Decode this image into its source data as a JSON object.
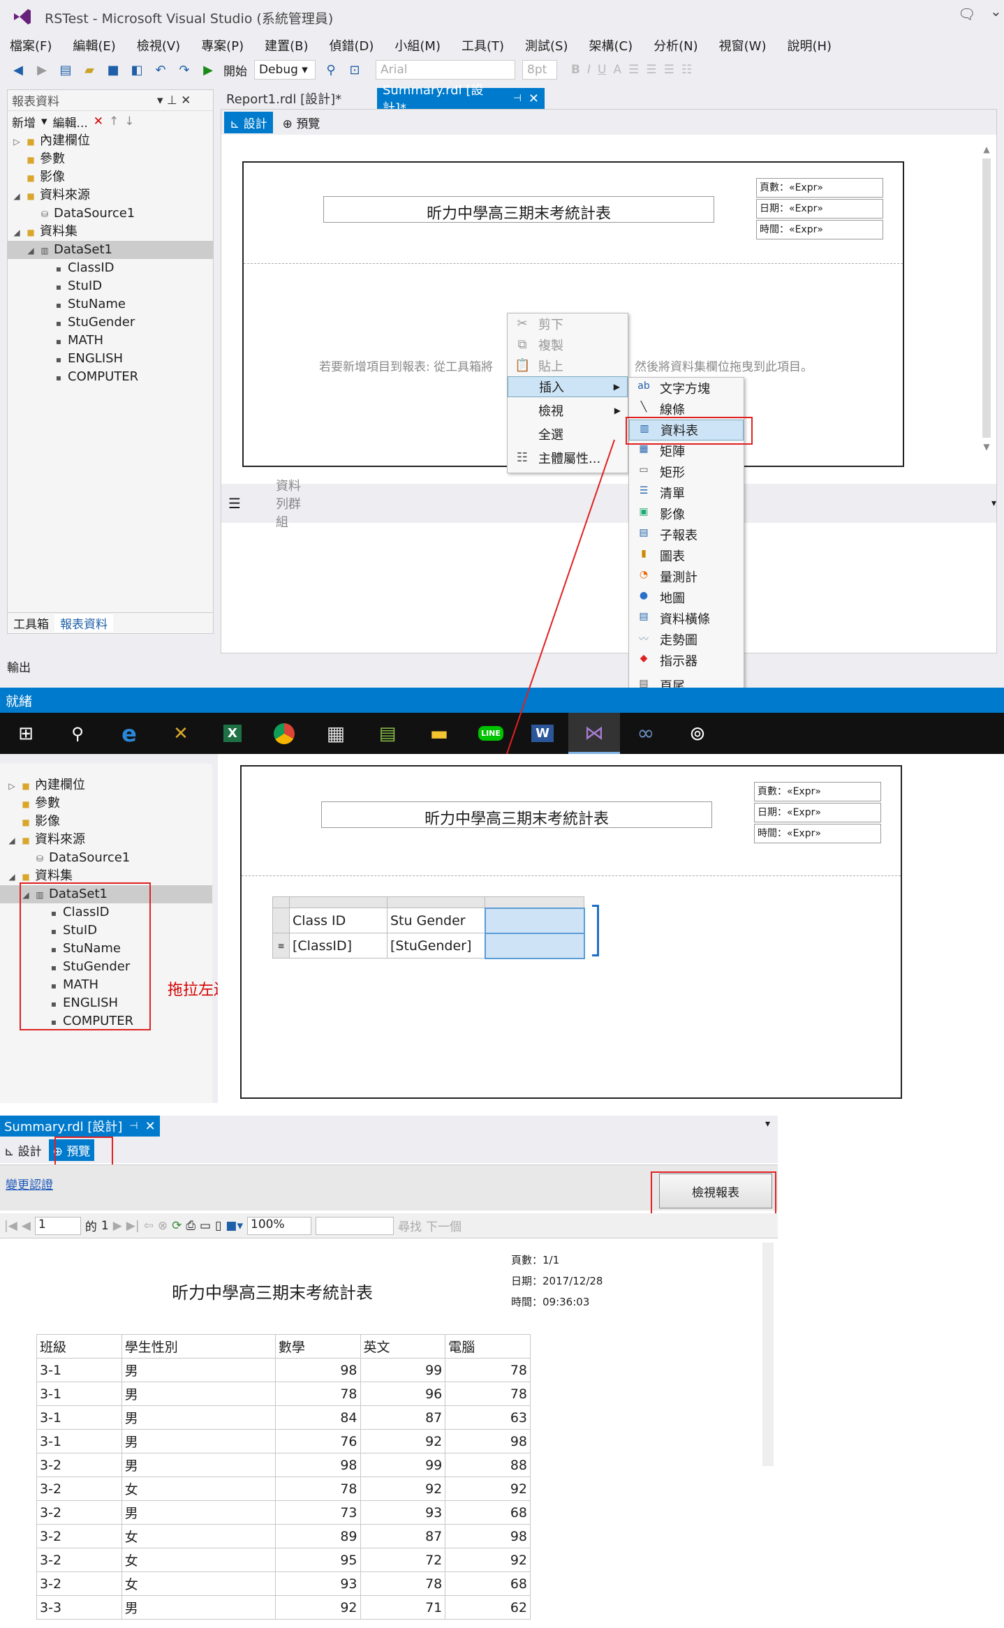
{
  "window": {
    "title": "RSTest - Microsoft Visual Studio (系統管理員)"
  },
  "menu": [
    "檔案(F)",
    "編輯(E)",
    "檢視(V)",
    "專案(P)",
    "建置(B)",
    "偵錯(D)",
    "小組(M)",
    "工具(T)",
    "測試(S)",
    "架構(C)",
    "分析(N)",
    "視窗(W)",
    "說明(H)"
  ],
  "toolbar": {
    "start": "開始",
    "config": "Debug",
    "font": "Arial",
    "size": "8pt"
  },
  "report_data_panel": {
    "title": "報表資料",
    "new": "新增",
    "edit": "編輯..."
  },
  "tree": {
    "builtin": "內建欄位",
    "params": "參數",
    "images": "影像",
    "datasources": "資料來源",
    "datasource1": "DataSource1",
    "datasets": "資料集",
    "dataset1": "DataSet1",
    "fields": [
      "ClassID",
      "StuID",
      "StuName",
      "StuGender",
      "MATH",
      "ENGLISH",
      "COMPUTER"
    ]
  },
  "bottom_tabs": {
    "toolbox": "工具箱",
    "report_data": "報表資料"
  },
  "output": "輸出",
  "doc_tabs": {
    "report1": "Report1.rdl [設計]*",
    "summary": "Summary.rdl [設計]*",
    "summary_clean": "Summary.rdl [設計]"
  },
  "view_tabs": {
    "design": "設計",
    "preview": "預覽"
  },
  "report": {
    "title": "昕力中學高三期末考統計表",
    "page_expr": "頁數：«Expr»",
    "date_expr": "日期：«Expr»",
    "time_expr": "時間：«Expr»",
    "hint_left": "若要新增項目到報表: 從工具箱將",
    "hint_right": "然後將資料集欄位拖曳到此項目。",
    "row_groups": "資料列群組"
  },
  "context_menu": {
    "cut": "剪下",
    "copy": "複製",
    "paste": "貼上",
    "insert": "插入",
    "view": "檢視",
    "select_all": "全選",
    "properties": "主體屬性..."
  },
  "insert_menu": [
    "文字方塊",
    "線條",
    "資料表",
    "矩陣",
    "矩形",
    "清單",
    "影像",
    "子報表",
    "圖表",
    "量測計",
    "地圖",
    "資料橫條",
    "走勢圖",
    "指示器",
    "頁尾"
  ],
  "status": "就緒",
  "table_design": {
    "h1": "Class ID",
    "h2": "Stu Gender",
    "d1": "[ClassID]",
    "d2": "[StuGender]"
  },
  "annotation": "拖拉左邊欄位放置在資料表所屬位置內",
  "preview": {
    "change_cred": "變更認證",
    "view_report": "檢視報表",
    "page": "1",
    "of": "的",
    "total": "1",
    "zoom": "100%",
    "find": "尋找",
    "next": "下一個",
    "page_info": "頁數：1/1",
    "date_info": "日期：2017/12/28",
    "time_info": "時間：09:36:03"
  },
  "result_table": {
    "headers": [
      "班級",
      "學生性別",
      "數學",
      "英文",
      "電腦"
    ],
    "rows": [
      [
        "3-1",
        "男",
        "98",
        "99",
        "78"
      ],
      [
        "3-1",
        "男",
        "78",
        "96",
        "78"
      ],
      [
        "3-1",
        "男",
        "84",
        "87",
        "63"
      ],
      [
        "3-1",
        "男",
        "76",
        "92",
        "98"
      ],
      [
        "3-2",
        "男",
        "98",
        "99",
        "88"
      ],
      [
        "3-2",
        "女",
        "78",
        "92",
        "92"
      ],
      [
        "3-2",
        "男",
        "73",
        "93",
        "68"
      ],
      [
        "3-2",
        "女",
        "89",
        "87",
        "98"
      ],
      [
        "3-2",
        "女",
        "95",
        "72",
        "92"
      ],
      [
        "3-2",
        "女",
        "93",
        "78",
        "68"
      ],
      [
        "3-3",
        "男",
        "92",
        "71",
        "62"
      ]
    ]
  }
}
